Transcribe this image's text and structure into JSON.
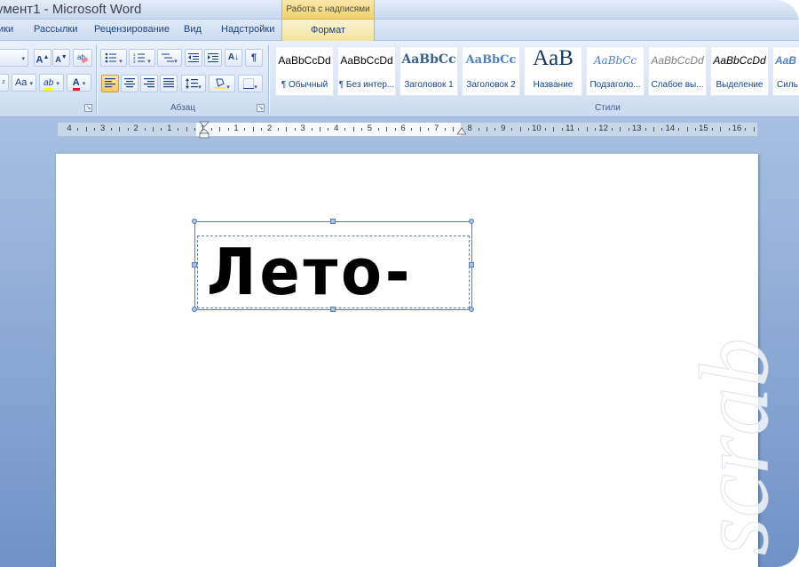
{
  "window": {
    "title": "умент1 - Microsoft Word",
    "context_tab_group": "Работа с надписями"
  },
  "ribbon_tabs": [
    "ики",
    "Рассылки",
    "Рецензирование",
    "Вид",
    "Надстройки",
    "Формат"
  ],
  "ribbon": {
    "font_group": {
      "grow_font": "A",
      "shrink_font": "A",
      "change_case": "Aa",
      "highlight": "ab",
      "font_color": "A"
    },
    "paragraph_group": {
      "label": "Абзац",
      "sort": "А↓",
      "show_marks": "¶"
    },
    "styles_group": {
      "label": "Стили",
      "items": [
        {
          "sample": "AaBbCcDd",
          "name": "¶ Обычный"
        },
        {
          "sample": "AaBbCcDd",
          "name": "¶ Без интер..."
        },
        {
          "sample": "AaBbCc",
          "name": "Заголовок 1"
        },
        {
          "sample": "AaBbCc",
          "name": "Заголовок 2"
        },
        {
          "sample": "AaB",
          "name": "Название"
        },
        {
          "sample": "AaBbCc",
          "name": "Подзаголо..."
        },
        {
          "sample": "AaBbCcDd",
          "name": "Слабое вы..."
        },
        {
          "sample": "AaBbCcDd",
          "name": "Выделение"
        },
        {
          "sample": "AaB",
          "name": "Силь"
        }
      ]
    }
  },
  "ruler": {
    "numbers": [
      "4",
      "3",
      "2",
      "1",
      "1",
      "1",
      "2",
      "3",
      "4",
      "5",
      "6",
      "7",
      "8",
      "9",
      "10",
      "11",
      "12",
      "13",
      "14",
      "15",
      "16"
    ]
  },
  "document": {
    "textbox_text": "Лето-"
  },
  "watermark_text": "scrab",
  "colors": {
    "accent": "#15428b",
    "context_tab": "#f1d26c",
    "highlight_yellow": "#ffff00",
    "font_color_red": "#e02020",
    "workspace": "#86a5d2"
  }
}
